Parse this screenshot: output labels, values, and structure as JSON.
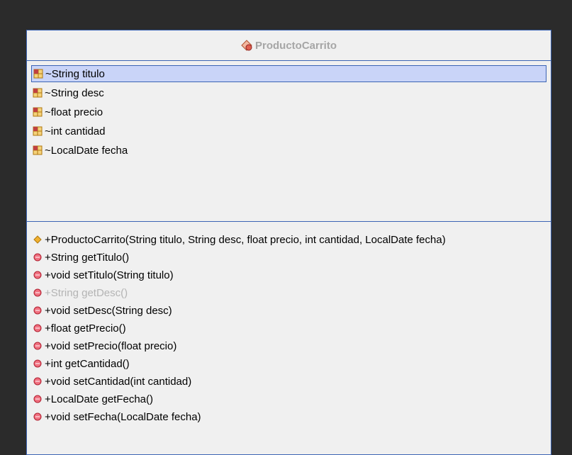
{
  "class_name": "ProductoCarrito",
  "attributes": [
    {
      "label": "~String titulo",
      "icon": "field-icon",
      "selected": true
    },
    {
      "label": "~String desc",
      "icon": "field-icon"
    },
    {
      "label": "~float precio",
      "icon": "field-icon"
    },
    {
      "label": "~int cantidad",
      "icon": "field-icon"
    },
    {
      "label": "~LocalDate fecha",
      "icon": "field-icon"
    }
  ],
  "operations": [
    {
      "label": "+ProductoCarrito(String titulo, String desc, float precio, int cantidad, LocalDate fecha)",
      "icon": "constructor-icon"
    },
    {
      "label": "+String getTitulo()",
      "icon": "method-icon"
    },
    {
      "label": "+void setTitulo(String titulo)",
      "icon": "method-icon"
    },
    {
      "label": "+String getDesc()",
      "icon": "method-icon",
      "disabled": true
    },
    {
      "label": "+void setDesc(String desc)",
      "icon": "method-icon"
    },
    {
      "label": "+float getPrecio()",
      "icon": "method-icon"
    },
    {
      "label": "+void setPrecio(float precio)",
      "icon": "method-icon"
    },
    {
      "label": "+int getCantidad()",
      "icon": "method-icon"
    },
    {
      "label": "+void setCantidad(int cantidad)",
      "icon": "method-icon"
    },
    {
      "label": "+LocalDate getFecha()",
      "icon": "method-icon"
    },
    {
      "label": "+void setFecha(LocalDate fecha)",
      "icon": "method-icon"
    }
  ],
  "colors": {
    "background": "#2b2b2b",
    "border": "#3c64b4",
    "selection": "#c9d4f8",
    "field_icon": "#e0a020",
    "method_icon": "#e04050",
    "constructor_icon": "#e8a020"
  }
}
